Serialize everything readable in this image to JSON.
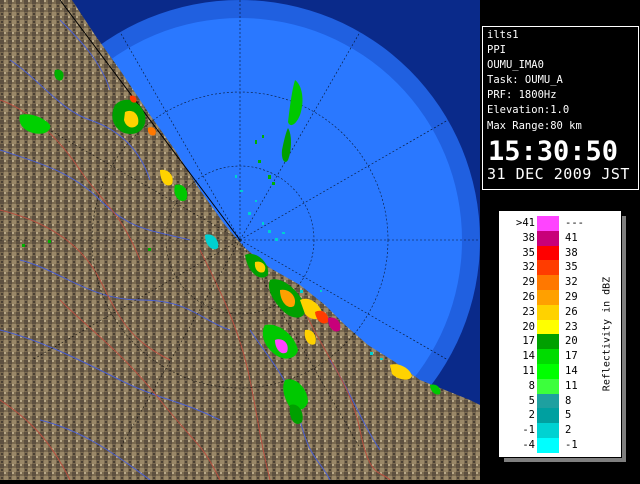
{
  "info": {
    "lines": [
      "ilts1",
      "PPI",
      "OUMU_IMA0",
      "Task: OUMU_A",
      "PRF: 1800Hz",
      "Elevation:1.0",
      "Max Range:80 km"
    ],
    "time": "15:30:50",
    "date": "31 DEC 2009 JST"
  },
  "legend": {
    "title": "Reflectivity in dBZ",
    "rows": [
      {
        "lo": ">41",
        "hi": "---",
        "color": "#ff44ff"
      },
      {
        "lo": "38",
        "hi": "41",
        "color": "#c8007a"
      },
      {
        "lo": "35",
        "hi": "38",
        "color": "#ff0000"
      },
      {
        "lo": "32",
        "hi": "35",
        "color": "#ff3c00"
      },
      {
        "lo": "29",
        "hi": "32",
        "color": "#ff7800"
      },
      {
        "lo": "26",
        "hi": "29",
        "color": "#ffa000"
      },
      {
        "lo": "23",
        "hi": "26",
        "color": "#ffd200"
      },
      {
        "lo": "20",
        "hi": "23",
        "color": "#ffff00"
      },
      {
        "lo": "17",
        "hi": "20",
        "color": "#00a000"
      },
      {
        "lo": "14",
        "hi": "17",
        "color": "#00dc00"
      },
      {
        "lo": "11",
        "hi": "14",
        "color": "#00ff00"
      },
      {
        "lo": "8",
        "hi": "11",
        "color": "#3cff3c"
      },
      {
        "lo": "5",
        "hi": "8",
        "color": "#1ea0a0"
      },
      {
        "lo": "2",
        "hi": "5",
        "color": "#00a0a0"
      },
      {
        "lo": "-1",
        "hi": "2",
        "color": "#00d2d2"
      },
      {
        "lo": "-4",
        "hi": "-1",
        "color": "#00ffff"
      }
    ]
  }
}
